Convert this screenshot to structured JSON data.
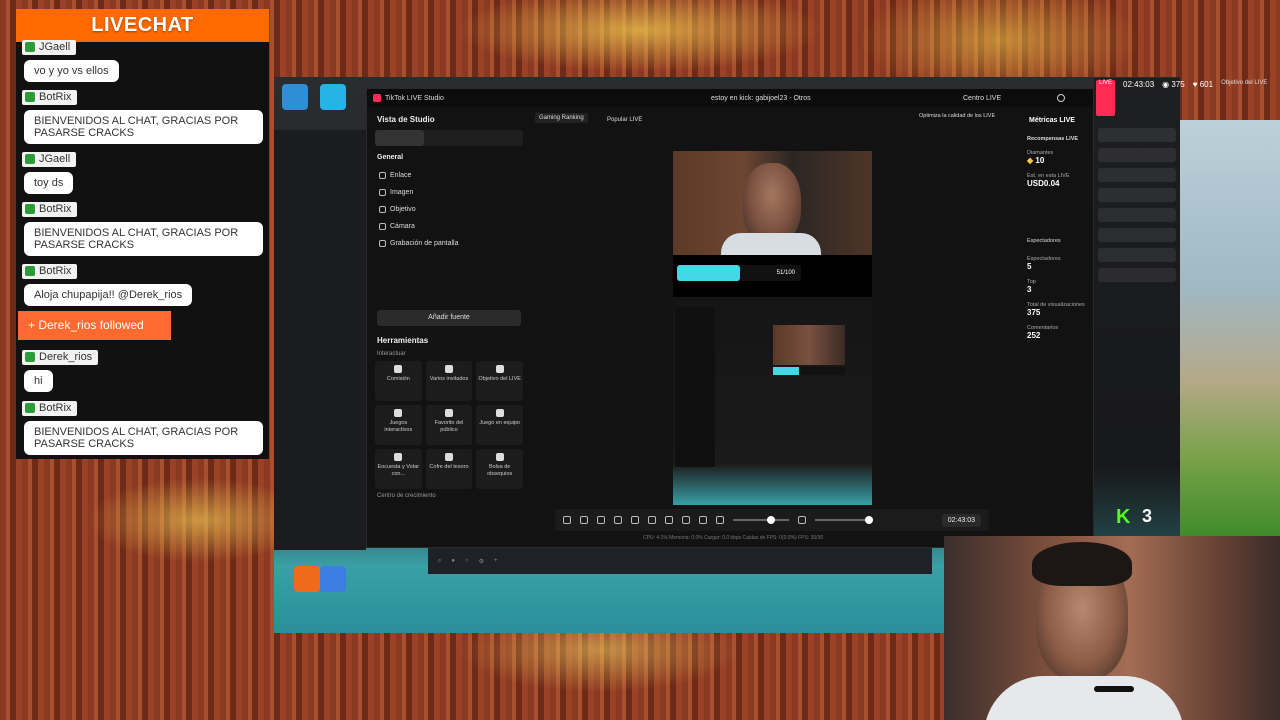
{
  "chat": {
    "title": "LIVECHAT",
    "messages": [
      {
        "user": "JGaell",
        "text": "vo y yo vs ellos"
      },
      {
        "user": "BotRix",
        "text": "BIENVENIDOS AL CHAT, GRACIAS POR PASARSE CRACKS"
      },
      {
        "user": "JGaell",
        "text": "toy ds"
      },
      {
        "user": "BotRix",
        "text": "BIENVENIDOS AL CHAT, GRACIAS POR PASARSE CRACKS"
      },
      {
        "user": "BotRix",
        "text": "Aloja chupapija!! @Derek_rios"
      },
      {
        "user": "Derek_rios",
        "text": "hi"
      },
      {
        "user": "BotRix",
        "text": "BIENVENIDOS AL CHAT, GRACIAS POR PASARSE CRACKS"
      }
    ],
    "follow_event": "Derek_rios followed"
  },
  "studio": {
    "app_title": "TikTok LIVE Studio",
    "stream_title": "estoy en kick: gabijoel23 - Otros",
    "centro_live": "Centro LIVE",
    "optimize_hint": "Optimiza la calidad de los LIVE",
    "side": {
      "view_label": "Vista de Studio",
      "section": "General",
      "sources": [
        "Enlace",
        "Imagen",
        "Objetivo",
        "Cámara",
        "Grabación de pantalla"
      ],
      "add_source": "Añadir fuente",
      "tools_title": "Herramientas",
      "tools_subtitle": "Interactuar",
      "tools": [
        "Comisión",
        "Varios invitados",
        "Objetivo del LIVE",
        "Juegos interactivos",
        "Favorito del público",
        "Juego en equipo",
        "Encuesta y Votar con...",
        "Cofre del tesoro",
        "Bolsa de obsequios"
      ],
      "growth": "Centro de crecimiento"
    },
    "top_tags": [
      "Gaming Ranking",
      "Popular LIVE"
    ],
    "goal_text": "51/100",
    "goal_fraction": 0.51,
    "toolbar_time": "02:43:03",
    "status_line": "CPU: 4.1%   Memoria: 0.0%   Cargar: 0.0 kbps   Caídas de FPS: 0(0.0%)   FPS: 30/30"
  },
  "metrics": {
    "title": "Métricas LIVE",
    "subtitle": "Recompensas LIVE",
    "diamonds_label": "Diamantes",
    "diamonds": "10",
    "est_label": "Est. en esta LIVE",
    "est": "USD0.04",
    "viewers_section": "Espectadores",
    "viewers_label": "Espectadores",
    "viewers": "5",
    "top_label": "Top",
    "top": "3",
    "total_label": "Total de visualizaciones",
    "total": "375",
    "comments_label": "Comentarios",
    "comments": "252"
  },
  "overlay": {
    "live_time": "02:43:03",
    "viewers": "375",
    "likes": "601",
    "goal_label": "Objetivo del LIVE",
    "kick_count": "3"
  },
  "colors": {
    "chat_header": "#ff6a00",
    "follow_event": "#ff6a2e",
    "goal_fill": "#42d9e6",
    "kick": "#53fc18"
  }
}
